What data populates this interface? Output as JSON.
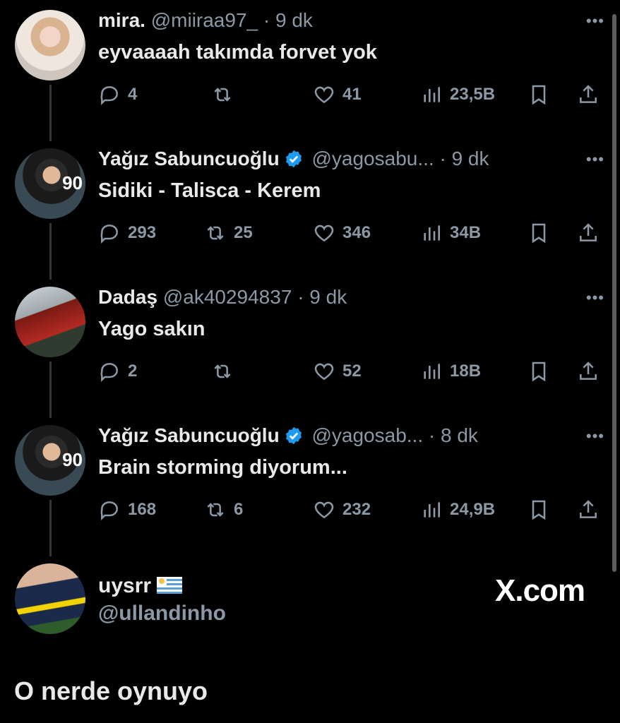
{
  "replies": [
    {
      "name": "mira.",
      "handle": "@miiraa97_",
      "separator": "·",
      "time": "9 dk",
      "verified": false,
      "text": "eyvaaaah takımda forvet yok",
      "replies": "4",
      "reposts": "",
      "likes": "41",
      "views": "23,5B"
    },
    {
      "name": "Yağız Sabuncuoğlu",
      "handle": "@yagosabu...",
      "separator": "·",
      "time": "9 dk",
      "verified": true,
      "text": "Sidiki - Talisca - Kerem",
      "replies": "293",
      "reposts": "25",
      "likes": "346",
      "views": "34B"
    },
    {
      "name": "Dadaş",
      "handle": "@ak40294837",
      "separator": "·",
      "time": "9 dk",
      "verified": false,
      "text": "Yago sakın",
      "replies": "2",
      "reposts": "",
      "likes": "52",
      "views": "18B"
    },
    {
      "name": "Yağız Sabuncuoğlu",
      "handle": "@yagosab...",
      "separator": "·",
      "time": "8 dk",
      "verified": true,
      "text": "Brain storming diyorum...",
      "replies": "168",
      "reposts": "6",
      "likes": "232",
      "views": "24,9B"
    }
  ],
  "more_label": "•••",
  "avatar_badge": "90",
  "original_post": {
    "name": "uysrr",
    "flag": "uruguay-flag",
    "handle": "@ullandinho",
    "text": "O nerde oynuyo"
  },
  "watermark": "X.com",
  "colors": {
    "background": "#000000",
    "text": "#e7e9ea",
    "muted": "#8b98a5",
    "verified": "#1d9bf0"
  }
}
